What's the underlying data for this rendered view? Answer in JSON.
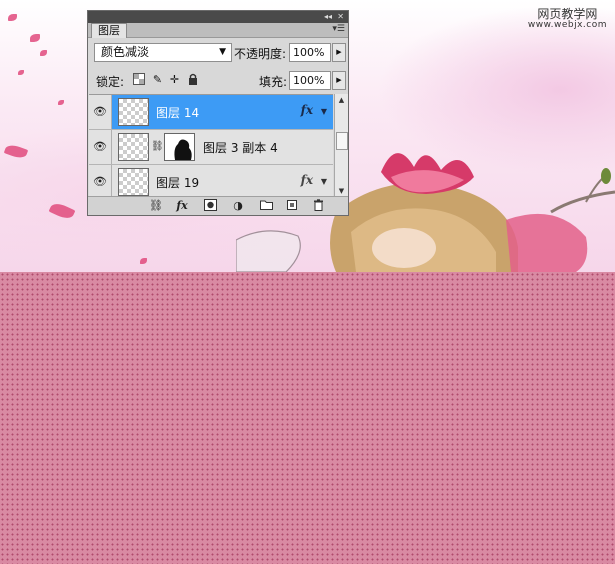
{
  "watermark": {
    "line1": "网页教学网",
    "line2": "www.webjx.com"
  },
  "panel": {
    "tab_label": "图层",
    "title_controls": {
      "collapse_icon": "double-left-arrow-icon",
      "close_icon": "close-icon"
    },
    "menu_icon": "panel-menu-icon",
    "blend_mode": "颜色减淡",
    "opacity_label": "不透明度:",
    "opacity_value": "100%",
    "lock_label": "锁定:",
    "lock_icons": [
      "lock-transparent-icon",
      "lock-image-icon",
      "lock-position-icon",
      "lock-all-icon"
    ],
    "fill_label": "填充:",
    "fill_value": "100%",
    "layers": [
      {
        "name": "图层 14",
        "selected": true,
        "visible": true,
        "has_fx": true,
        "has_mask": false
      },
      {
        "name": "图层 3 副本 4",
        "selected": false,
        "visible": true,
        "has_fx": false,
        "has_mask": true
      },
      {
        "name": "图层 19",
        "selected": false,
        "visible": true,
        "has_fx": true,
        "has_mask": false
      }
    ],
    "fx_label": "fx",
    "bottom_buttons": [
      "link-icon",
      "fx-icon",
      "mask-icon",
      "adjustment-icon",
      "group-folder-icon",
      "new-layer-icon",
      "trash-icon"
    ]
  },
  "colors": {
    "selected_row": "#3d9bf5",
    "pattern_bg": "#d98aa3",
    "pattern_dot": "#b04a6c"
  }
}
